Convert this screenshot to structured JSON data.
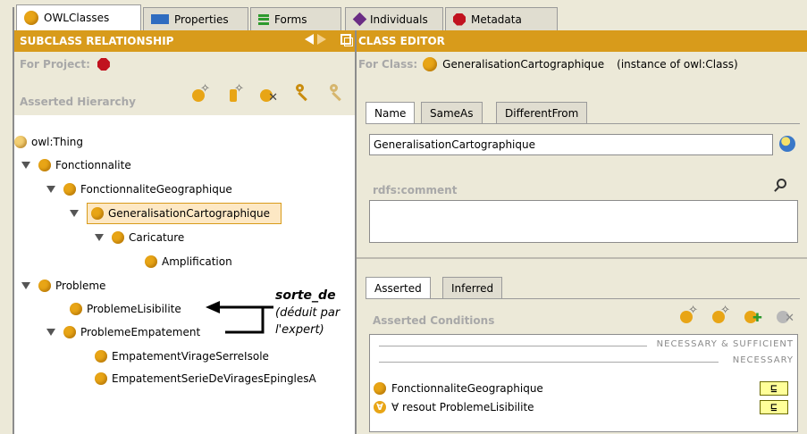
{
  "tabs": [
    {
      "label": "OWLClasses",
      "icon": "owl-class-icon"
    },
    {
      "label": "Properties",
      "icon": "properties-icon"
    },
    {
      "label": "Forms",
      "icon": "forms-icon"
    },
    {
      "label": "Individuals",
      "icon": "individuals-icon"
    },
    {
      "label": "Metadata",
      "icon": "metadata-icon"
    }
  ],
  "left": {
    "header": "SUBCLASS RELATIONSHIP",
    "for_project": "For Project:",
    "hierarchy_title": "Asserted Hierarchy",
    "tree": [
      {
        "label": "owl:Thing"
      },
      {
        "label": "Fonctionnalite"
      },
      {
        "label": "FonctionnaliteGeographique"
      },
      {
        "label": "GeneralisationCartographique",
        "selected": true
      },
      {
        "label": "Caricature"
      },
      {
        "label": "Amplification"
      },
      {
        "label": "Probleme"
      },
      {
        "label": "ProblemeLisibilite"
      },
      {
        "label": "ProblemeEmpatement"
      },
      {
        "label": "EmpatementVirageSerreIsole"
      },
      {
        "label": "EmpatementSerieDeViragesEpinglesA"
      }
    ],
    "annotation": {
      "title": "sorte_de",
      "line1": "(déduit par",
      "line2": "l'expert)"
    }
  },
  "right": {
    "header": "CLASS EDITOR",
    "for_class_label": "For Class:",
    "for_class_value": "GeneralisationCartographique",
    "instance_of": "(instance of owl:Class)",
    "name_tabs": [
      "Name",
      "SameAs",
      "DifferentFrom"
    ],
    "name_value": "GeneralisationCartographique",
    "rdfs_comment": "rdfs:comment",
    "cond_tabs": [
      "Asserted",
      "Inferred"
    ],
    "asserted_conditions": "Asserted Conditions",
    "nec_suf": "NECESSARY & SUFFICIENT",
    "necessary": "NECESSARY",
    "conditions": [
      {
        "text": "FonctionnaliteGeographique",
        "badge": "⊑"
      },
      {
        "text": "∀ resout ProblemeLisibilite",
        "badge": "⊑"
      }
    ]
  },
  "colors": {
    "header": "#d89b1b",
    "class": "#e8a516",
    "selection": "#fde8c4"
  }
}
